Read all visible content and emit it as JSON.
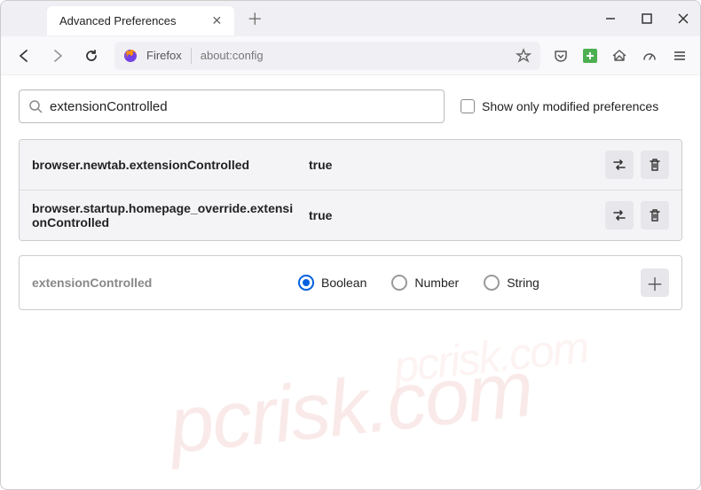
{
  "titlebar": {
    "tab_title": "Advanced Preferences"
  },
  "toolbar": {
    "url_label": "Firefox",
    "url_text": "about:config"
  },
  "search": {
    "input_value": "extensionControlled",
    "checkbox_label": "Show only modified preferences"
  },
  "prefs": [
    {
      "name": "browser.newtab.extensionControlled",
      "value": "true"
    },
    {
      "name": "browser.startup.homepage_override.extensionControlled",
      "value": "true"
    }
  ],
  "new_pref": {
    "name": "extensionControlled",
    "types": [
      "Boolean",
      "Number",
      "String"
    ],
    "selected": "Boolean"
  },
  "watermark": "pcrisk.com"
}
